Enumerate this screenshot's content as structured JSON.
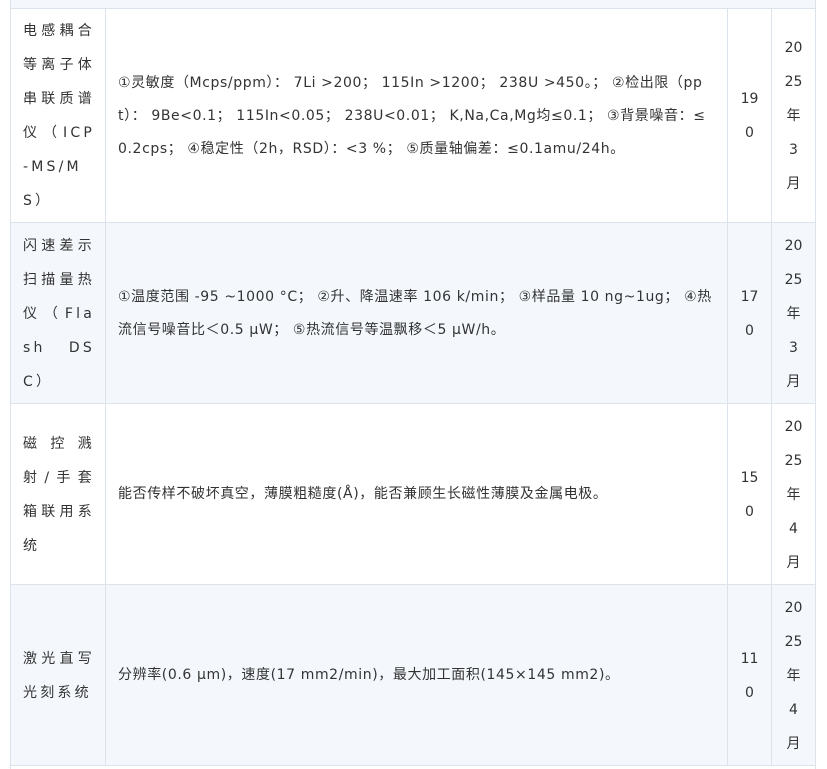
{
  "rows": [
    {
      "name": "电感耦合等离子体串联质谱仪（ICP-MS/MS）",
      "spec": "①灵敏度（Mcps/ppm）： 7Li >200； 115In >1200； 238U >450。； ②检出限（ppt）： 9Be<0.1； 115In<0.05； 238U<0.01； K,Na,Ca,Mg均≤0.1； ③背景噪音：≤0.2cps； ④稳定性（2h，RSD）：<3 %； ⑤质量轴偏差：≤0.1amu/24h。",
      "qty": "190",
      "date": "2025年3月"
    },
    {
      "name": "闪速差示扫描量热仪（Flash DSC）",
      "spec": "①温度范围 -95 ~1000 °C； ②升、降温速率 106 k/min； ③样品量 10 ng~1ug； ④热流信号噪音比＜0.5 μW； ⑤热流信号等温飘移＜5 μW/h。",
      "qty": "170",
      "date": "2025年3月"
    },
    {
      "name": "磁控溅射/手套箱联用系统",
      "spec": "能否传样不破坏真空，薄膜粗糙度(Å)，能否兼顾生长磁性薄膜及金属电极。",
      "qty": "150",
      "date": "2025年4月"
    },
    {
      "name": "激光直写光刻系统",
      "spec": "分辨率(0.6 μm)，速度(17 mm2/min)，最大加工面积(145×145 mm2)。",
      "qty": "110",
      "date": "2025年4月"
    }
  ]
}
